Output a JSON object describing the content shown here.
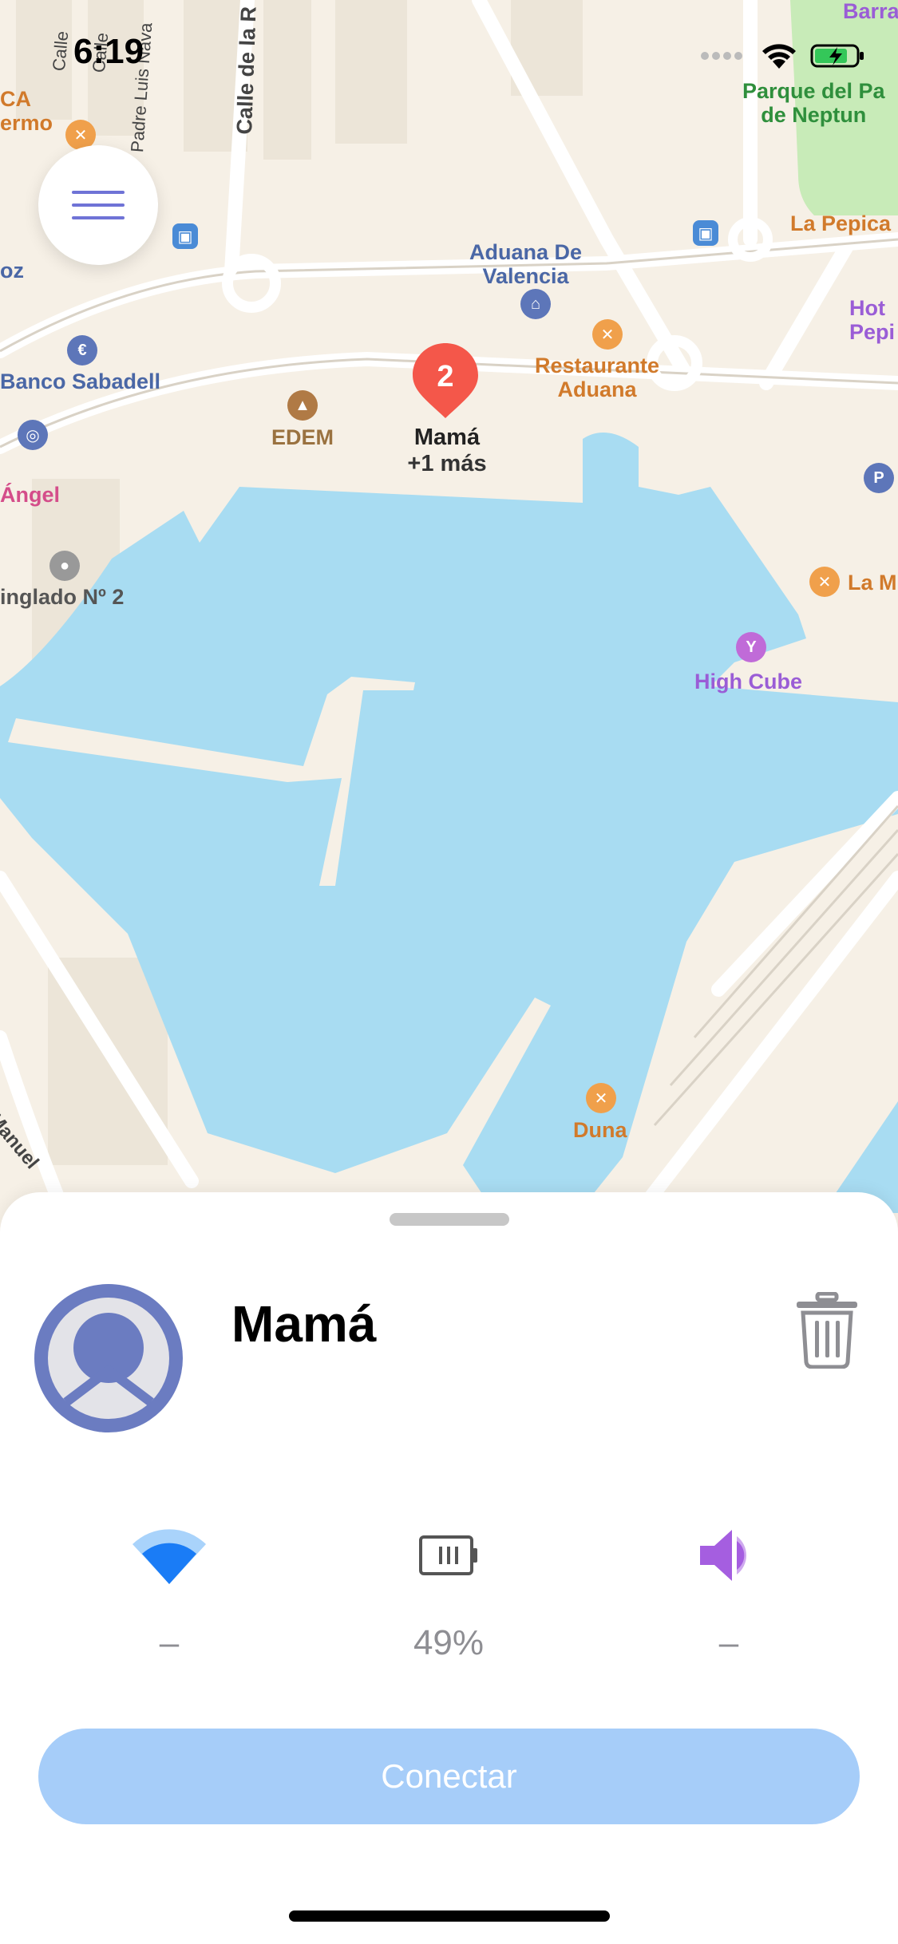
{
  "status_bar": {
    "time": "6:19"
  },
  "map": {
    "labels": {
      "aduana": "Aduana De\nValencia",
      "restaurante": "Restaurante\nAduana",
      "banco": "Banco Sabadell",
      "edem": "EDEM",
      "angel": "Ángel",
      "tinglado": "inglado Nº 2",
      "high_cube": "High Cube",
      "duna": "Duna",
      "la_m": "La M",
      "la_pepica": "La Pepica",
      "parque": "Parque del Pa\nde Neptun",
      "hotel": "Hot\nPepi",
      "barra": "Barra",
      "ca": "CA\nermo",
      "oz": "oz",
      "calle_r": "Calle de la R",
      "padre": "Padre Luis Nava",
      "calle_left": "Calle",
      "calle_left2": "Calle",
      "manuel": "Manuel"
    },
    "cluster": {
      "count": "2",
      "name": "Mamá",
      "more": "+1 más"
    }
  },
  "sheet": {
    "contact_name": "Mamá",
    "metrics": {
      "wifi_value": "–",
      "battery_value": "49%",
      "volume_value": "–"
    },
    "connect_label": "Conectar"
  },
  "colors": {
    "water": "#a8dcf2",
    "land": "#f6f0e6",
    "park": "#c8ebb8",
    "accent_avatar": "#6b7cc1",
    "wifi_blue": "#1a7cf6",
    "volume_purple": "#a55ee0",
    "pin_red": "#f4574a",
    "connect_bg": "#a6cdf9"
  }
}
